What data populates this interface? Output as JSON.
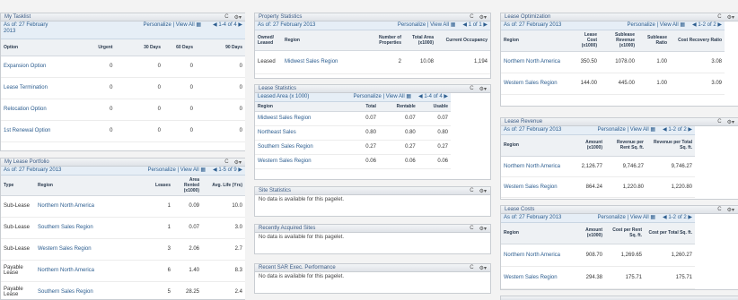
{
  "common": {
    "personalize": "Personalize",
    "view_all": "View All",
    "sep": "|",
    "refresh": "C",
    "gear": "⚙▾"
  },
  "tasklist": {
    "title": "My Tasklist",
    "as_of": "As of: 27 February 2013",
    "nav": "1-4 of 4",
    "cols": [
      "Option",
      "Urgent",
      "30 Days",
      "60 Days",
      "90 Days"
    ],
    "rows": [
      [
        "Expansion Option",
        "0",
        "0",
        "0",
        "0"
      ],
      [
        "Lease Termination",
        "0",
        "0",
        "0",
        "0"
      ],
      [
        "Relocation Option",
        "0",
        "0",
        "0",
        "0"
      ],
      [
        "1st Renewal Option",
        "0",
        "0",
        "0",
        "0"
      ]
    ]
  },
  "portfolio": {
    "title": "My Lease Portfolio",
    "as_of": "As of: 27 February 2013",
    "nav": "1-5 of 9",
    "cols": [
      "Type",
      "Region",
      "Leases",
      "Area Rented (x1000)",
      "Avg. Life (Yrs)"
    ],
    "rows": [
      [
        "Sub-Lease",
        "Northern North America",
        "1",
        "0.09",
        "10.0"
      ],
      [
        "Sub-Lease",
        "Southern Sales Region",
        "1",
        "0.07",
        "3.0"
      ],
      [
        "Sub-Lease",
        "Western Sales Region",
        "3",
        "2.06",
        "2.7"
      ],
      [
        "Payable Lease",
        "Northern North America",
        "6",
        "1.40",
        "8.3"
      ],
      [
        "Payable Lease",
        "Southern Sales Region",
        "5",
        "28.25",
        "2.4"
      ]
    ]
  },
  "property": {
    "title": "Property Statistics",
    "as_of": "As of: 27 February 2013",
    "nav": "1 of 1",
    "cols": [
      "Owned/ Leased",
      "Region",
      "Number of Properties",
      "Total Area (x1000)",
      "Current Occupancy"
    ],
    "rows": [
      [
        "Leased",
        "Midwest Sales Region",
        "2",
        "10.08",
        "1,194"
      ]
    ]
  },
  "lease_stats": {
    "title": "Lease Statistics",
    "sub": "Leased Area (x 1000)",
    "nav": "1-4 of 4",
    "cols": [
      "Region",
      "Total",
      "Rentable",
      "Usable"
    ],
    "rows": [
      [
        "Midwest Sales Region",
        "0.07",
        "0.07",
        "0.07"
      ],
      [
        "Northeast Sales",
        "0.80",
        "0.80",
        "0.80"
      ],
      [
        "Southern Sales Region",
        "0.27",
        "0.27",
        "0.27"
      ],
      [
        "Western Sales Region",
        "0.06",
        "0.06",
        "0.06"
      ]
    ]
  },
  "site_stats": {
    "title": "Site Statistics",
    "msg": "No data is available for this pagelet."
  },
  "recent_sites": {
    "title": "Recently Acquired Sites",
    "msg": "No data is available for this pagelet."
  },
  "sar": {
    "title": "Recent SAR Exec. Performance",
    "msg": "No data is available for this pagelet."
  },
  "optimization": {
    "title": "Lease Optimization",
    "as_of": "As of: 27 February 2013",
    "nav": "1-2 of 2",
    "cols": [
      "Region",
      "Lease Cost (x1000)",
      "Sublease Revenue (x1000)",
      "Sublease Ratio",
      "Cost Recovery Ratio"
    ],
    "rows": [
      [
        "Northern North America",
        "350.50",
        "1078.00",
        "1.00",
        "3.08"
      ],
      [
        "Western Sales Region",
        "144.00",
        "445.00",
        "1.00",
        "3.09"
      ]
    ]
  },
  "revenue": {
    "title": "Lease Revenue",
    "as_of": "As of: 27 February 2013",
    "nav": "1-2 of 2",
    "cols": [
      "Region",
      "Amount (x1000)",
      "Revenue per Rent Sq. ft.",
      "Revenue per Total Sq. ft."
    ],
    "rows": [
      [
        "Northern North America",
        "2,126.77",
        "9,746.27",
        "9,746.27"
      ],
      [
        "Western Sales Region",
        "864.24",
        "1,220.80",
        "1,220.80"
      ]
    ]
  },
  "costs": {
    "title": "Lease Costs",
    "as_of": "As of: 27 February 2013",
    "nav": "1-2 of 2",
    "cols": [
      "Region",
      "Amount (x1000)",
      "Cost per Rent Sq. ft.",
      "Cost per Total Sq. ft."
    ],
    "rows": [
      [
        "Northern North America",
        "908.70",
        "1,269.65",
        "1,260.27"
      ],
      [
        "Western Sales Region",
        "294.38",
        "175.71",
        "175.71"
      ]
    ]
  }
}
